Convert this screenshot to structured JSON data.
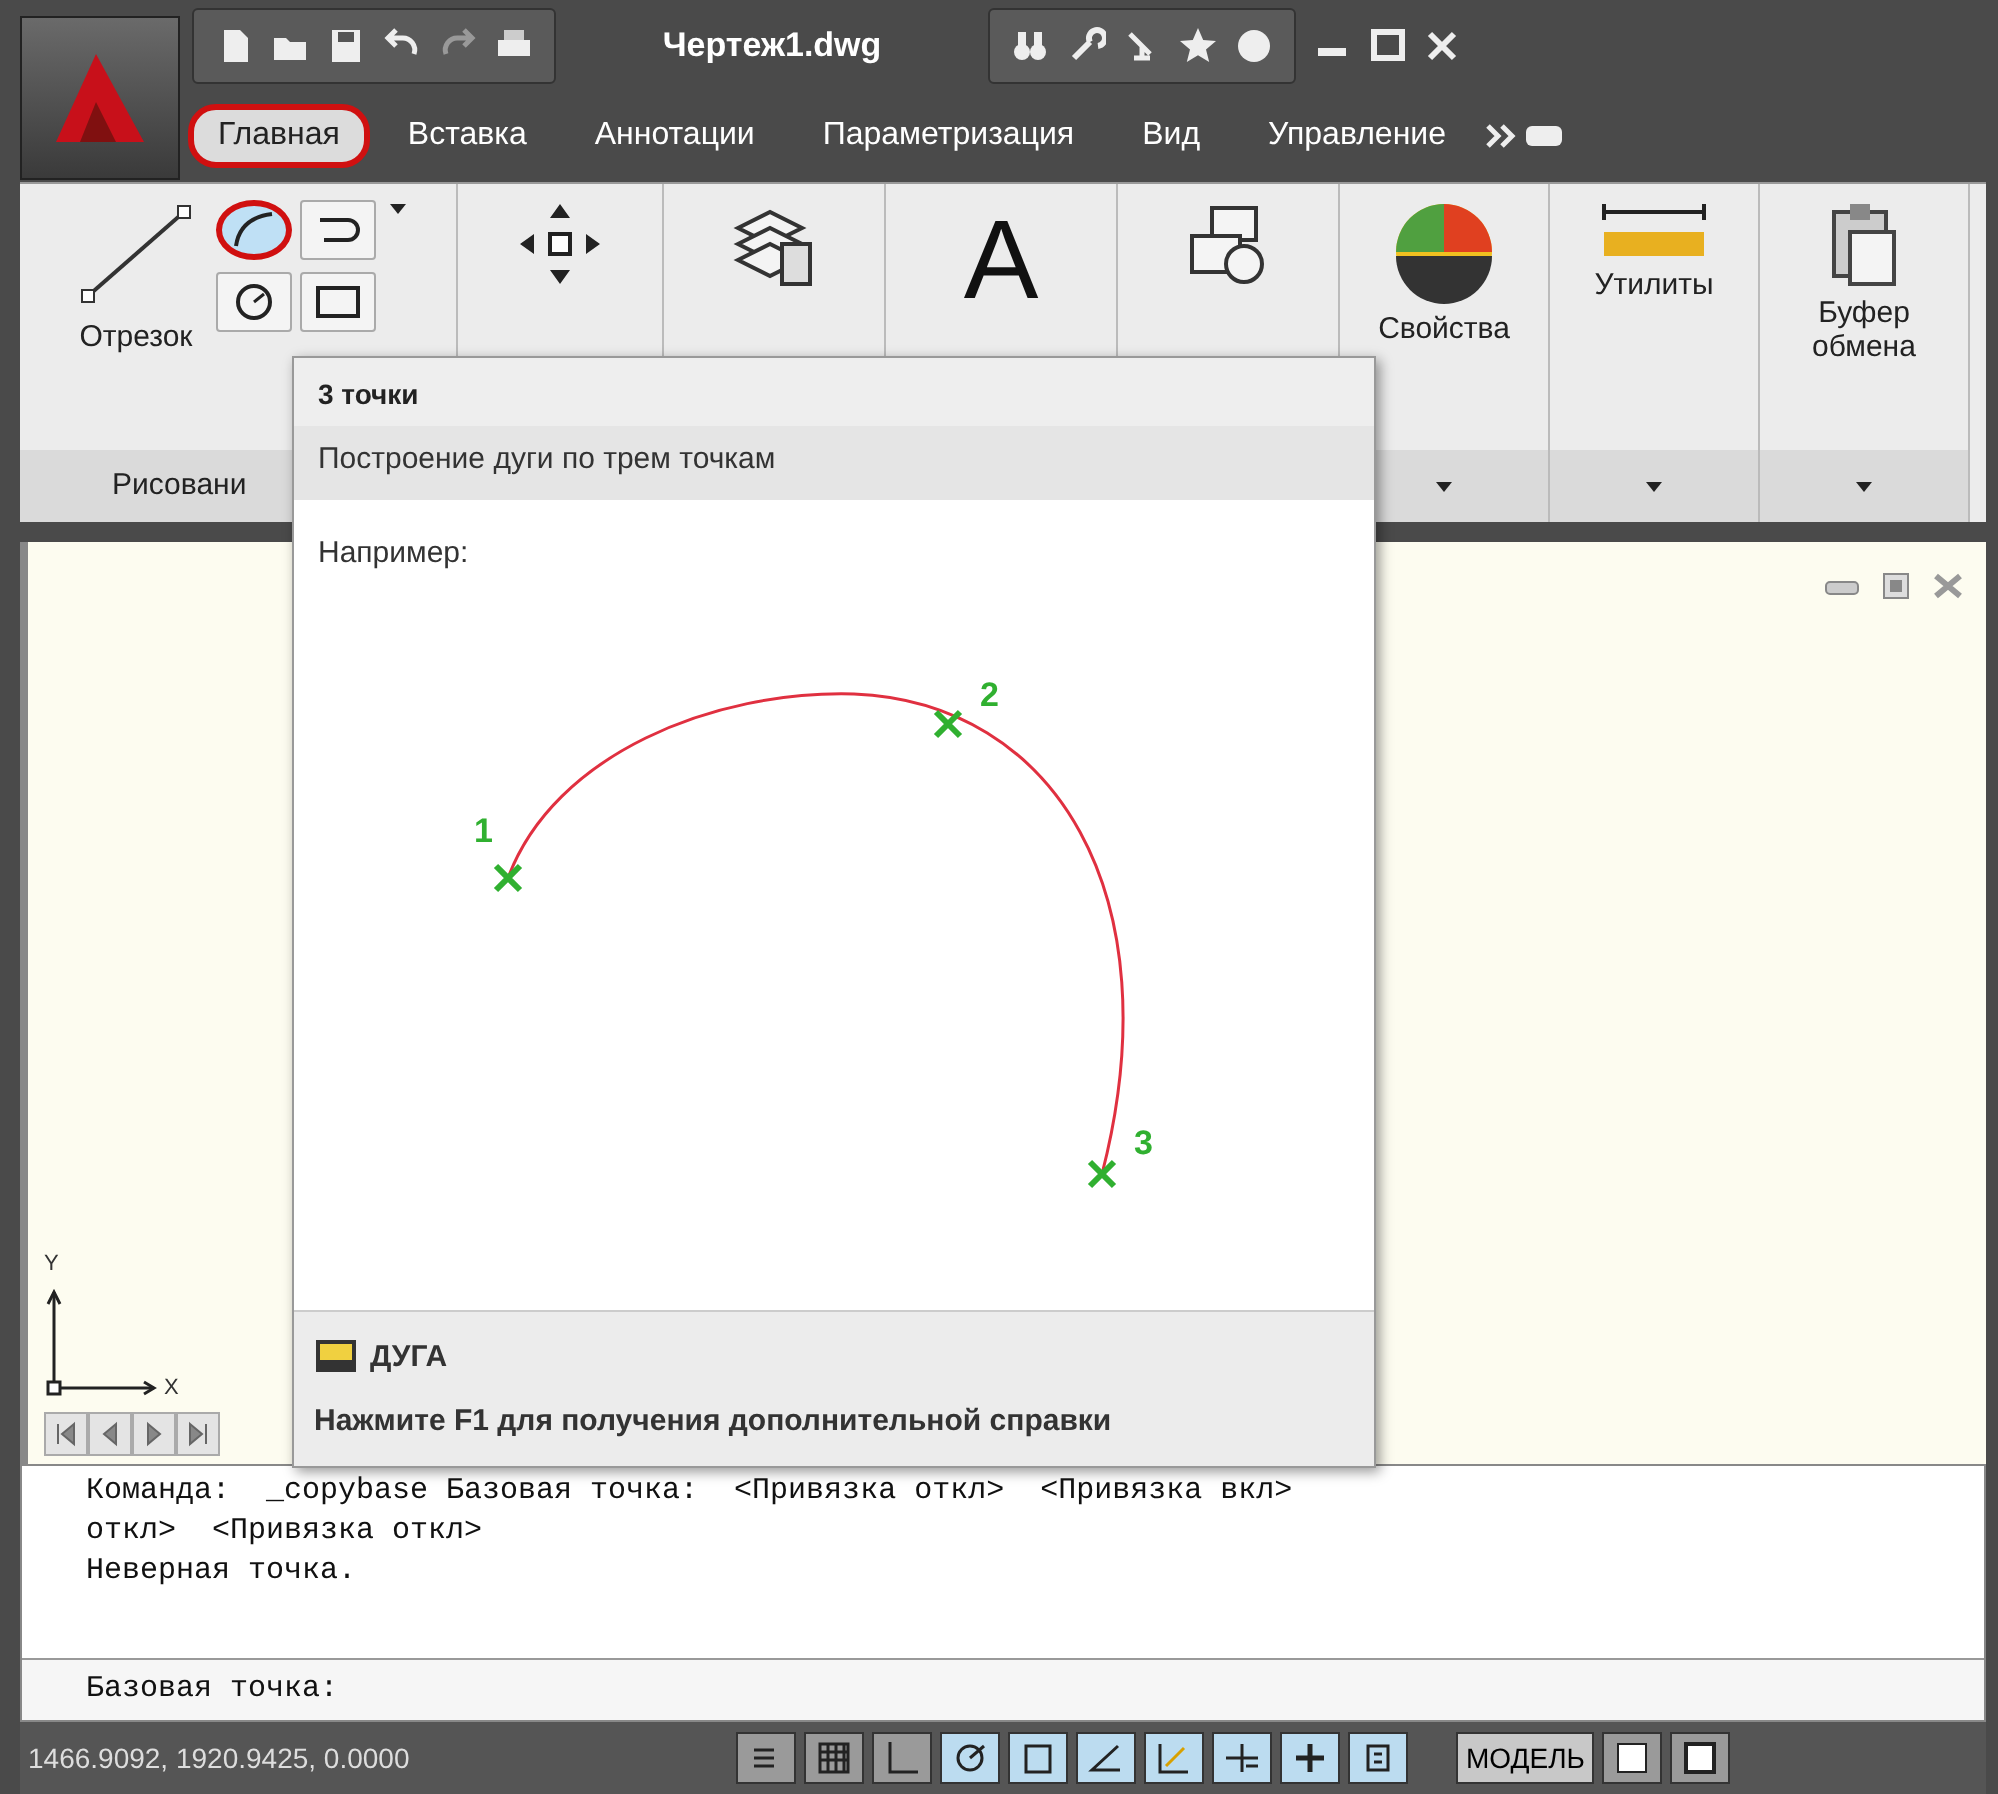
{
  "app_title": "Чертеж1.dwg",
  "ribbon_tabs": [
    {
      "label": "Главная",
      "selected": true
    },
    {
      "label": "Вставка",
      "selected": false
    },
    {
      "label": "Аннотации",
      "selected": false
    },
    {
      "label": "Параметризация",
      "selected": false
    },
    {
      "label": "Вид",
      "selected": false
    },
    {
      "label": "Управление",
      "selected": false
    }
  ],
  "ribbon": {
    "line_button": "Отрезок",
    "draw_tools": [
      {
        "kind": "arc",
        "selected": true
      },
      {
        "kind": "polyline",
        "selected": false
      },
      {
        "kind": "circle",
        "selected": false
      },
      {
        "kind": "rectangle",
        "selected": false
      }
    ],
    "draw_panel_label": "Рисовани",
    "annotation_glyph": "A",
    "properties": "Свойства",
    "utilities": "Утилиты",
    "clipboard": "Буфер обмена"
  },
  "tooltip": {
    "title": "3 точки",
    "description": "Построение дуги по трем точкам",
    "example_label": "Например:",
    "points": [
      "1",
      "2",
      "3"
    ],
    "command": "ДУГА",
    "help": "Нажмите F1 для получения дополнительной справки"
  },
  "ucs": {
    "y": "Y",
    "x": "X"
  },
  "command_line": {
    "history": [
      "Команда:  _copybase Базовая точка:  <Привязка откл>  <Привязка вкл>",
      "откл>  <Привязка откл>",
      "Неверная точка."
    ],
    "prompt": "Базовая точка:"
  },
  "status_bar": {
    "coordinates": "1466.9092, 1920.9425, 0.0000",
    "toggles": [
      {
        "kind": "snap",
        "on": false
      },
      {
        "kind": "grid",
        "on": false
      },
      {
        "kind": "ortho",
        "on": false
      },
      {
        "kind": "polar",
        "on": true
      },
      {
        "kind": "osnap",
        "on": true
      },
      {
        "kind": "otrack",
        "on": true
      },
      {
        "kind": "ducs",
        "on": true
      },
      {
        "kind": "dyn",
        "on": true
      },
      {
        "kind": "lwt",
        "on": true
      },
      {
        "kind": "qp",
        "on": true
      }
    ],
    "model": "МОДЕЛЬ"
  }
}
